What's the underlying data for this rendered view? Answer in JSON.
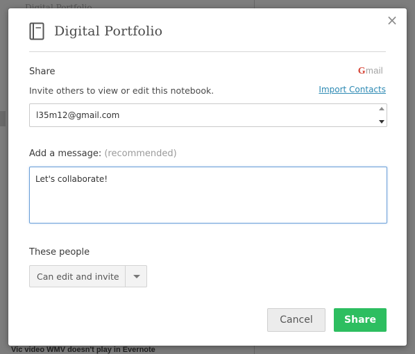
{
  "background": {
    "top_text": "Digital Portfolio",
    "bottom_text": "Vic video WMV doesn't play in Evernote"
  },
  "dialog": {
    "title": "Digital Portfolio",
    "close_label": "×",
    "share": {
      "label": "Share",
      "gmail_logo": "Gmail",
      "helper": "Invite others to view or edit this notebook.",
      "import_link": "Import Contacts",
      "email_value": "l35m12@gmail.com"
    },
    "message": {
      "label": "Add a message:",
      "label_hint": "(recommended)",
      "value": "Let's collaborate!"
    },
    "people": {
      "label": "These people",
      "permission": "Can edit and invite"
    },
    "buttons": {
      "cancel": "Cancel",
      "share": "Share"
    }
  },
  "colors": {
    "share_button": "#2dbe60",
    "link": "#2c89b3",
    "focus_border": "#6a9fd8"
  },
  "icons": {
    "title_icon": "notebook-icon",
    "close_icon": "close-icon"
  }
}
